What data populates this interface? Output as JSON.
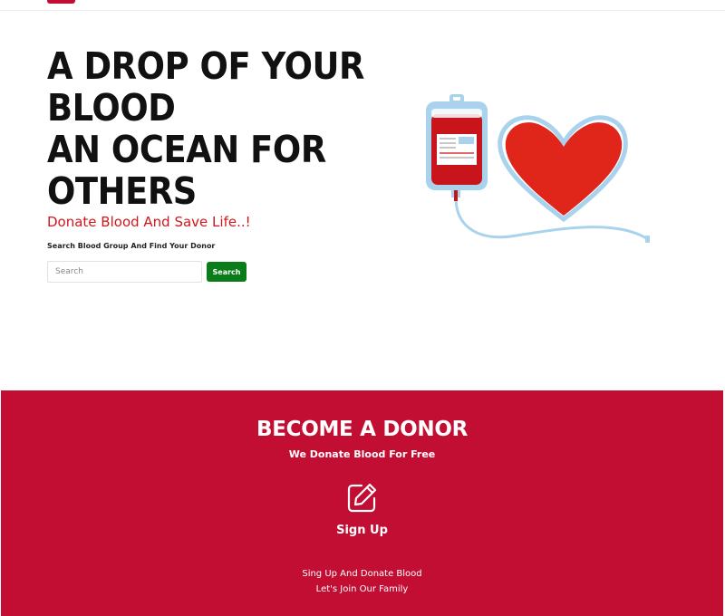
{
  "hero": {
    "headline_lines": [
      "A DROP OF YOUR",
      "BLOOD",
      "AN OCEAN FOR",
      "OTHERS"
    ],
    "tagline": "Donate Blood And Save Life..!",
    "search_label": "Search Blood Group And Find Your Donor",
    "search_placeholder": "Search",
    "search_button": "Search"
  },
  "donor": {
    "title": "BECOME A DONOR",
    "subtitle": "We Donate Blood For Free",
    "icon": "edit-icon",
    "signup_label": "Sign Up",
    "description_lines": [
      "Sing Up And Donate Blood",
      "Let's Join Our Family"
    ]
  },
  "colors": {
    "brand_red": "#c20e33",
    "tagline_red": "#d0171c",
    "search_green": "#0a7c1a",
    "heart_red": "#e0261b",
    "tube_blue": "#a9d3ec"
  }
}
